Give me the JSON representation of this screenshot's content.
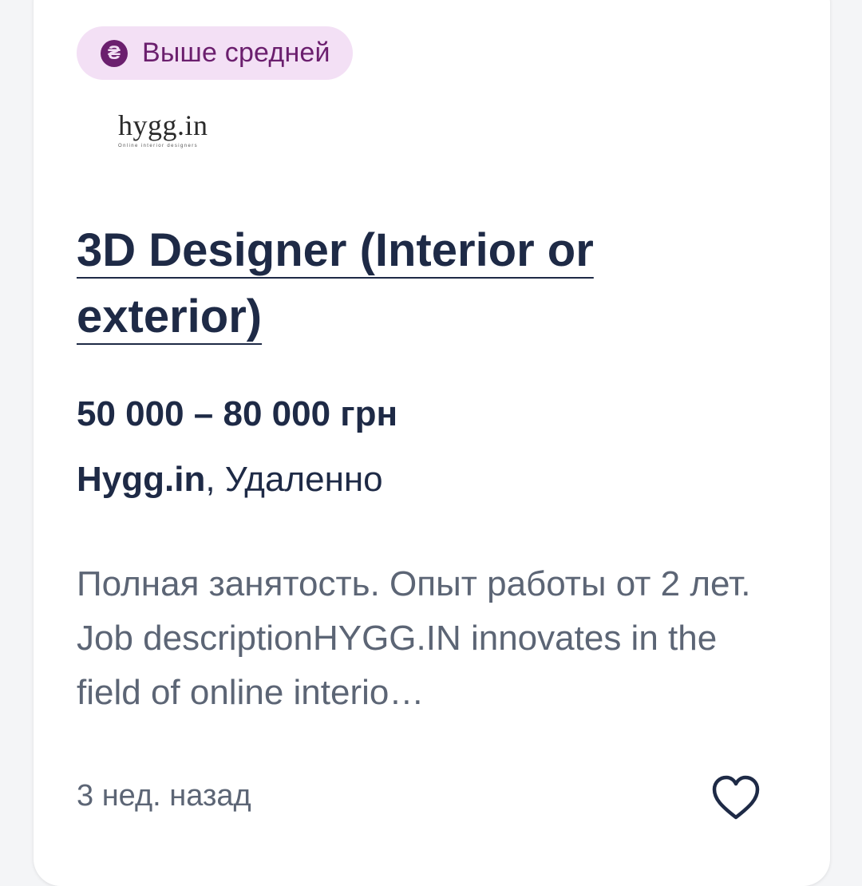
{
  "badge": {
    "icon": "hryvnia-icon",
    "icon_glyph": "₴",
    "label": "Выше средней"
  },
  "logo": {
    "text": "hygg.in",
    "tagline": "Online interior designers"
  },
  "vacancy": {
    "title": "3D Designer (Interior or exterior)",
    "salary": "50 000 – 80 000 грн",
    "company": "Hygg.in",
    "location": ", Удаленно",
    "description": "Полная занятость. Опыт работы от 2 лет. Job descriptionHYGG.IN innovates in the field of online interio…",
    "posted": "3 нед. назад"
  },
  "actions": {
    "favorite_icon": "heart-icon"
  },
  "colors": {
    "badge_bg": "#f3e0f5",
    "badge_fg": "#6b1f6e",
    "title": "#1e2a46",
    "muted": "#5c6575"
  }
}
